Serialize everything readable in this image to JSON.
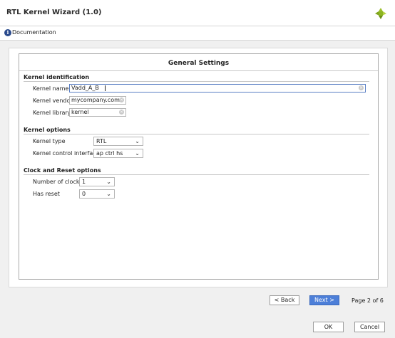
{
  "window": {
    "title": "RTL Kernel Wizard (1.0)"
  },
  "docbar": {
    "info_glyph": "i",
    "documentation_label": "Documentation"
  },
  "panel": {
    "title": "General Settings",
    "sections": {
      "kernel_identification": {
        "title": "Kernel identification",
        "name_label": "Kernel name",
        "name_value": "Vadd_A_B",
        "vendor_label": "Kernel vendor",
        "vendor_value": "mycompany.com",
        "library_label": "Kernel library",
        "library_value": "kernel"
      },
      "kernel_options": {
        "title": "Kernel options",
        "type_label": "Kernel type",
        "type_value": "RTL",
        "control_label": "Kernel control interface",
        "control_value": "ap ctrl hs"
      },
      "clock_reset": {
        "title": "Clock and Reset options",
        "clocks_label": "Number of clocks",
        "clocks_value": "1",
        "reset_label": "Has reset",
        "reset_value": "0"
      }
    }
  },
  "nav": {
    "back_label": "< Back",
    "next_label": "Next >",
    "page_info": "Page 2 of 6"
  },
  "footer": {
    "ok_label": "OK",
    "cancel_label": "Cancel"
  },
  "icons": {
    "clear": "clear-icon",
    "chevron": "chevron-down-icon",
    "info": "info-icon",
    "logo": "vivado-logo-icon"
  },
  "colors": {
    "accent": "#4d7fd8",
    "logo_green": "#9bbf2a",
    "info_blue": "#2a4a8c"
  }
}
